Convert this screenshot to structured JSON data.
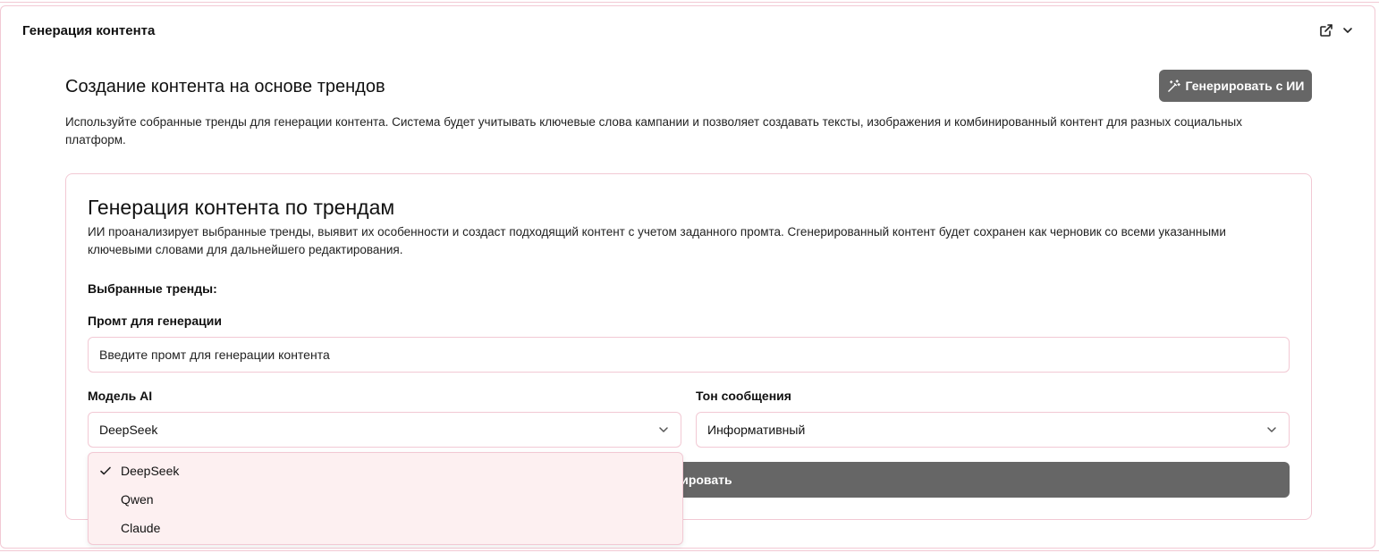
{
  "panel": {
    "title": "Генерация контента"
  },
  "section": {
    "title": "Создание контента на основе трендов",
    "ai_button_label": "Генерировать с ИИ",
    "description": "Используйте собранные тренды для генерации контента. Система будет учитывать ключевые слова кампании и позволяет создавать тексты, изображения и комбинированный контент для разных социальных платформ."
  },
  "card": {
    "title": "Генерация контента по трендам",
    "description": "ИИ проанализирует выбранные тренды, выявит их особенности и создаст подходящий контент с учетом заданного промта. Сгенерированный контент будет сохранен как черновик со всеми указанными ключевыми словами для дальнейшего редактирования.",
    "selected_trends_label": "Выбранные тренды:",
    "prompt_label": "Промт для генерации",
    "prompt_placeholder": "Введите промт для генерации контента",
    "model_label": "Модель AI",
    "model_value": "DeepSeek",
    "tone_label": "Тон сообщения",
    "tone_value": "Информативный",
    "generate_button_label": "Генерировать"
  },
  "model_dropdown": {
    "options": [
      {
        "label": "DeepSeek",
        "selected": true
      },
      {
        "label": "Qwen",
        "selected": false
      },
      {
        "label": "Claude",
        "selected": false
      }
    ]
  },
  "icons": {
    "external": "external-link-icon",
    "chevron": "chevron-down-icon",
    "wand": "magic-wand-icon",
    "check": "check-icon"
  },
  "colors": {
    "accent_border": "#f2c9d4",
    "button_bg": "#666666",
    "dropdown_bg": "#fdf0f1"
  }
}
